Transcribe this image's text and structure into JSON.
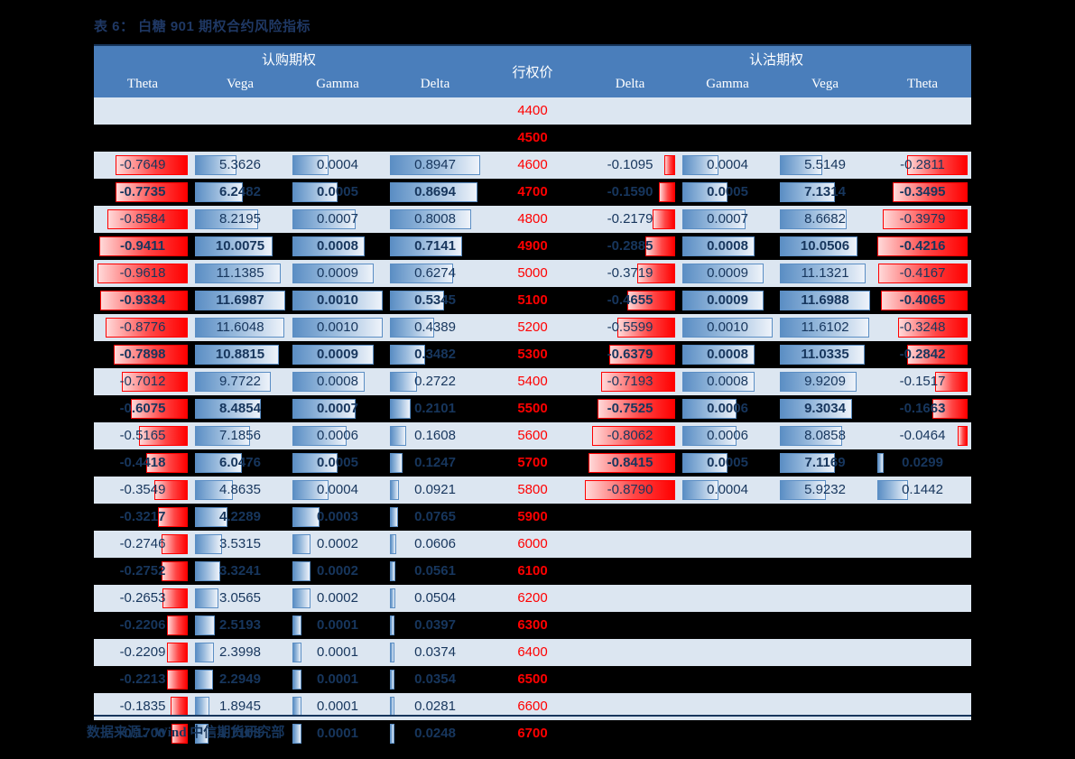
{
  "title": "表 6： 白糖 901 期权合约风险指标",
  "source": "数据来源：Wind  中信期货研究部",
  "colors": {
    "header_bg": "#4a7ebb",
    "row_light": "#dce6f1",
    "row_dark": "#000000",
    "strike_text": "#ff0000",
    "number_text": "#17365d",
    "bar_blue": "#5b8ec4",
    "bar_red": "#ff0000",
    "title_text": "#1f3864"
  },
  "header": {
    "call_group": "认购期权",
    "put_group": "认沽期权",
    "strike_label": "行权价",
    "call_cols": [
      "Theta",
      "Vega",
      "Gamma",
      "Delta"
    ],
    "put_cols": [
      "Delta",
      "Gamma",
      "Vega",
      "Theta"
    ]
  },
  "chart_data": {
    "type": "table",
    "title": "表 6： 白糖 901 期权合约风险指标",
    "columns": [
      "Theta",
      "Vega",
      "Gamma",
      "Delta",
      "行权价",
      "Delta",
      "Gamma",
      "Vega",
      "Theta"
    ],
    "column_groups": [
      "认购期权",
      "认购期权",
      "认购期权",
      "认购期权",
      "行权价",
      "认沽期权",
      "认沽期权",
      "认沽期权",
      "认沽期权"
    ],
    "rows": [
      {
        "strike": "4400",
        "call_theta": "",
        "call_vega": "",
        "call_gamma": "",
        "call_delta": "",
        "put_delta": "",
        "put_gamma": "",
        "put_vega": "",
        "put_theta": ""
      },
      {
        "strike": "4500",
        "call_theta": "",
        "call_vega": "",
        "call_gamma": "",
        "call_delta": "",
        "put_delta": "",
        "put_gamma": "",
        "put_vega": "",
        "put_theta": ""
      },
      {
        "strike": "4600",
        "call_theta": "-0.7649",
        "call_vega": "5.3626",
        "call_gamma": "0.0004",
        "call_delta": "0.8947",
        "put_delta": "-0.1095",
        "put_gamma": "0.0004",
        "put_vega": "5.5149",
        "put_theta": "-0.2811"
      },
      {
        "strike": "4700",
        "call_theta": "-0.7735",
        "call_vega": "6.2482",
        "call_gamma": "0.0005",
        "call_delta": "0.8694",
        "put_delta": "-0.1590",
        "put_gamma": "0.0005",
        "put_vega": "7.1314",
        "put_theta": "-0.3495"
      },
      {
        "strike": "4800",
        "call_theta": "-0.8584",
        "call_vega": "8.2195",
        "call_gamma": "0.0007",
        "call_delta": "0.8008",
        "put_delta": "-0.2179",
        "put_gamma": "0.0007",
        "put_vega": "8.6682",
        "put_theta": "-0.3979"
      },
      {
        "strike": "4900",
        "call_theta": "-0.9411",
        "call_vega": "10.0075",
        "call_gamma": "0.0008",
        "call_delta": "0.7141",
        "put_delta": "-0.2885",
        "put_gamma": "0.0008",
        "put_vega": "10.0506",
        "put_theta": "-0.4216"
      },
      {
        "strike": "5000",
        "call_theta": "-0.9618",
        "call_vega": "11.1385",
        "call_gamma": "0.0009",
        "call_delta": "0.6274",
        "put_delta": "-0.3719",
        "put_gamma": "0.0009",
        "put_vega": "11.1321",
        "put_theta": "-0.4167"
      },
      {
        "strike": "5100",
        "call_theta": "-0.9334",
        "call_vega": "11.6987",
        "call_gamma": "0.0010",
        "call_delta": "0.5345",
        "put_delta": "-0.4655",
        "put_gamma": "0.0009",
        "put_vega": "11.6988",
        "put_theta": "-0.4065"
      },
      {
        "strike": "5200",
        "call_theta": "-0.8776",
        "call_vega": "11.6048",
        "call_gamma": "0.0010",
        "call_delta": "0.4389",
        "put_delta": "-0.5599",
        "put_gamma": "0.0010",
        "put_vega": "11.6102",
        "put_theta": "-0.3248"
      },
      {
        "strike": "5300",
        "call_theta": "-0.7898",
        "call_vega": "10.8815",
        "call_gamma": "0.0009",
        "call_delta": "0.3482",
        "put_delta": "-0.6379",
        "put_gamma": "0.0008",
        "put_vega": "11.0335",
        "put_theta": "-0.2842"
      },
      {
        "strike": "5400",
        "call_theta": "-0.7012",
        "call_vega": "9.7722",
        "call_gamma": "0.0008",
        "call_delta": "0.2722",
        "put_delta": "-0.7193",
        "put_gamma": "0.0008",
        "put_vega": "9.9209",
        "put_theta": "-0.1517"
      },
      {
        "strike": "5500",
        "call_theta": "-0.6075",
        "call_vega": "8.4854",
        "call_gamma": "0.0007",
        "call_delta": "0.2101",
        "put_delta": "-0.7525",
        "put_gamma": "0.0006",
        "put_vega": "9.3034",
        "put_theta": "-0.1663"
      },
      {
        "strike": "5600",
        "call_theta": "-0.5165",
        "call_vega": "7.1856",
        "call_gamma": "0.0006",
        "call_delta": "0.1608",
        "put_delta": "-0.8062",
        "put_gamma": "0.0006",
        "put_vega": "8.0858",
        "put_theta": "-0.0464"
      },
      {
        "strike": "5700",
        "call_theta": "-0.4418",
        "call_vega": "6.0476",
        "call_gamma": "0.0005",
        "call_delta": "0.1247",
        "put_delta": "-0.8415",
        "put_gamma": "0.0005",
        "put_vega": "7.1169",
        "put_theta": "0.0299"
      },
      {
        "strike": "5800",
        "call_theta": "-0.3549",
        "call_vega": "4.8635",
        "call_gamma": "0.0004",
        "call_delta": "0.0921",
        "put_delta": "-0.8790",
        "put_gamma": "0.0004",
        "put_vega": "5.9232",
        "put_theta": "0.1442"
      },
      {
        "strike": "5900",
        "call_theta": "-0.3217",
        "call_vega": "4.2289",
        "call_gamma": "0.0003",
        "call_delta": "0.0765",
        "put_delta": "",
        "put_gamma": "",
        "put_vega": "",
        "put_theta": ""
      },
      {
        "strike": "6000",
        "call_theta": "-0.2746",
        "call_vega": "3.5315",
        "call_gamma": "0.0002",
        "call_delta": "0.0606",
        "put_delta": "",
        "put_gamma": "",
        "put_vega": "",
        "put_theta": ""
      },
      {
        "strike": "6100",
        "call_theta": "-0.2752",
        "call_vega": "3.3241",
        "call_gamma": "0.0002",
        "call_delta": "0.0561",
        "put_delta": "",
        "put_gamma": "",
        "put_vega": "",
        "put_theta": ""
      },
      {
        "strike": "6200",
        "call_theta": "-0.2653",
        "call_vega": "3.0565",
        "call_gamma": "0.0002",
        "call_delta": "0.0504",
        "put_delta": "",
        "put_gamma": "",
        "put_vega": "",
        "put_theta": ""
      },
      {
        "strike": "6300",
        "call_theta": "-0.2206",
        "call_vega": "2.5193",
        "call_gamma": "0.0001",
        "call_delta": "0.0397",
        "put_delta": "",
        "put_gamma": "",
        "put_vega": "",
        "put_theta": ""
      },
      {
        "strike": "6400",
        "call_theta": "-0.2209",
        "call_vega": "2.3998",
        "call_gamma": "0.0001",
        "call_delta": "0.0374",
        "put_delta": "",
        "put_gamma": "",
        "put_vega": "",
        "put_theta": ""
      },
      {
        "strike": "6500",
        "call_theta": "-0.2213",
        "call_vega": "2.2949",
        "call_gamma": "0.0001",
        "call_delta": "0.0354",
        "put_delta": "",
        "put_gamma": "",
        "put_vega": "",
        "put_theta": ""
      },
      {
        "strike": "6600",
        "call_theta": "-0.1835",
        "call_vega": "1.8945",
        "call_gamma": "0.0001",
        "call_delta": "0.0281",
        "put_delta": "",
        "put_gamma": "",
        "put_vega": "",
        "put_theta": ""
      },
      {
        "strike": "6700",
        "call_theta": "-0.1700",
        "call_vega": "1.7103",
        "call_gamma": "0.0001",
        "call_delta": "0.0248",
        "put_delta": "",
        "put_gamma": "",
        "put_vega": "",
        "put_theta": ""
      }
    ]
  }
}
